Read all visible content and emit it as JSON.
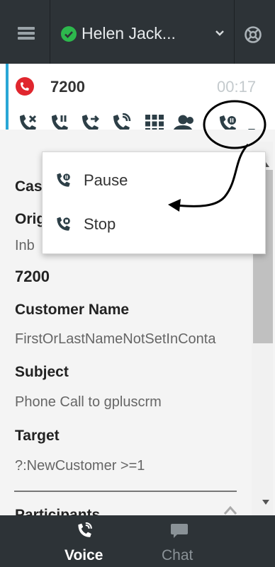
{
  "header": {
    "agent_name": "Helen Jack...",
    "status_color": "#2db84d"
  },
  "call": {
    "number": "7200",
    "timer": "00:17",
    "accent_color": "#2aa7d6",
    "end_icon_color": "#e0262e"
  },
  "toolbar": {
    "icons": [
      "hang-up-icon",
      "hold-icon",
      "transfer-icon",
      "conference-icon",
      "keypad-icon",
      "consult-icon",
      "record-menu-icon"
    ]
  },
  "dropdown": {
    "items": [
      {
        "label": "Pause",
        "icon": "pause-recording-icon"
      },
      {
        "label": "Stop",
        "icon": "stop-recording-icon"
      }
    ]
  },
  "case": {
    "case_label_partial": "Cas",
    "origin_label_partial": "Orig",
    "origin_value_partial": "Inb",
    "number_value": "7200",
    "customer_name_label": "Customer Name",
    "customer_name_value": "FirstOrLastNameNotSetInConta",
    "subject_label": "Subject",
    "subject_value": "Phone Call to gpluscrm",
    "target_label": "Target",
    "target_value": "?:NewCustomer >=1",
    "participants_label": "Participants"
  },
  "bottom_nav": {
    "voice_label": "Voice",
    "chat_label": "Chat"
  }
}
